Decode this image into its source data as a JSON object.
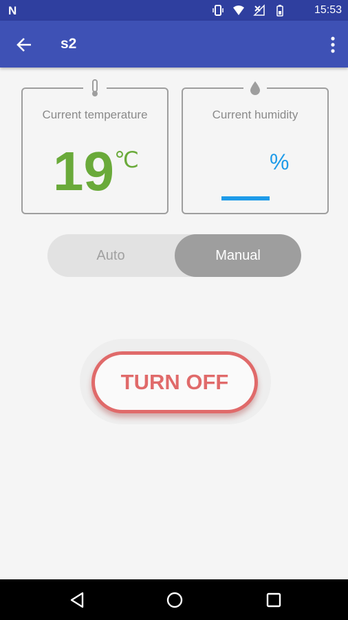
{
  "status_bar": {
    "time": "15:53",
    "left_icon": "notification-n-icon",
    "icons": [
      "vibrate-icon",
      "wifi-icon",
      "no-signal-icon",
      "battery-icon"
    ]
  },
  "app_bar": {
    "title": "s2",
    "back_icon": "arrow-back-icon",
    "menu_icon": "more-vert-icon"
  },
  "temperature_card": {
    "label": "Current temperature",
    "value": "19",
    "unit": "℃",
    "icon": "thermometer-icon"
  },
  "humidity_card": {
    "label": "Current humidity",
    "value": "",
    "unit": "%",
    "icon": "water-drop-icon"
  },
  "mode_toggle": {
    "options": [
      "Auto",
      "Manual"
    ],
    "selected": "Manual"
  },
  "power_button": {
    "label": "TURN OFF"
  },
  "nav_bar": {
    "buttons": [
      "back-triangle-icon",
      "home-circle-icon",
      "recent-square-icon"
    ]
  },
  "colors": {
    "status_bar": "#2f3f9f",
    "app_bar": "#3e51b5",
    "temperature": "#6aaa3a",
    "humidity": "#1e9be9",
    "turn_off": "#e06a6a"
  }
}
